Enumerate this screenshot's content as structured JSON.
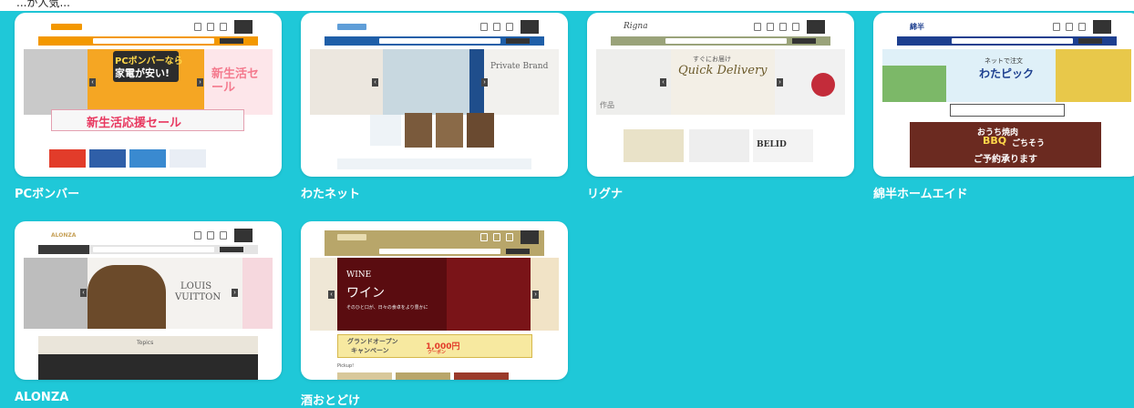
{
  "header_fragment": "...が人気...",
  "shops": [
    {
      "name": "PCボンバー",
      "logo_text": "PCボンバー",
      "hero_lines": [
        "PCボンバーなら",
        "家電が安い!"
      ],
      "side_text": "新生活セール",
      "banner_text": "新生活応援セール",
      "accent": "#f39800"
    },
    {
      "name": "わたネット",
      "logo_text": "わたネット",
      "hero_text": "Private Brand",
      "accent": "#1f5fa8"
    },
    {
      "name": "リグナ",
      "logo_text": "Rigna",
      "hero_text": "Quick Delivery",
      "hero_sub": "すぐにお届け",
      "side_text": "作品",
      "banner_text": "BELID",
      "accent": "#9aa37a"
    },
    {
      "name": "綿半ホームエイド",
      "logo_text": "綿半",
      "hero_lines": [
        "ネットで注文",
        "わたピック"
      ],
      "banner_lines": [
        "おうち焼肉",
        "BBQ",
        "ごちそう",
        "ご予約承ります"
      ],
      "accent": "#1d3f8f"
    },
    {
      "name": "ALONZA",
      "logo_text": "ALONZA",
      "hero_lines": [
        "LOUIS",
        "VUITTON"
      ],
      "section_text": "Topics",
      "accent": "#c7a25a"
    },
    {
      "name": "酒おとどけ",
      "logo_text": "酒おとどけ",
      "hero_lines": [
        "WINE",
        "ワイン"
      ],
      "hero_sub": "そのひと口が、日々の食卓をより豊かに",
      "banner_lines": [
        "グランドオープン",
        "キャンペーン",
        "1,000円",
        "クーポン"
      ],
      "section_text": "Pickup!",
      "accent": "#b8a66a"
    }
  ]
}
